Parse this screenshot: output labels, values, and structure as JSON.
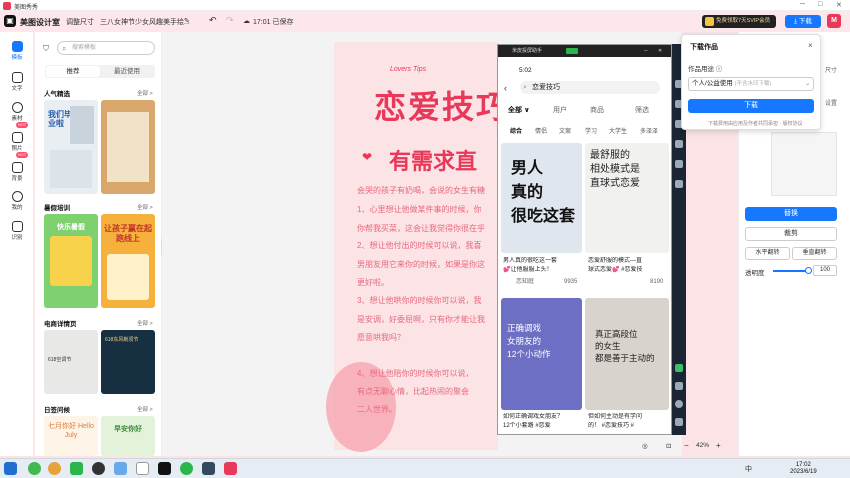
{
  "titlebar": {
    "app_title": "美图秀秀",
    "min": "─",
    "max": "□",
    "close": "✕"
  },
  "toolbar": {
    "brand": "美图设计室",
    "resize": "调整尺寸",
    "doc_title": "三八女神节少女风趣美手绘...",
    "save_status": "17:01 已保存",
    "vip": "免费领取7天SVIP会员",
    "download": "下载",
    "avatar": "M"
  },
  "leftnav": [
    {
      "label": "模板",
      "icon": "template-icon"
    },
    {
      "label": "文字",
      "icon": "text-icon"
    },
    {
      "label": "素材",
      "icon": "material-icon"
    },
    {
      "label": "照片",
      "icon": "photo-icon"
    },
    {
      "label": "背景",
      "icon": "background-icon"
    },
    {
      "label": "我的",
      "icon": "my-icon"
    },
    {
      "label": "识别",
      "icon": "recognize-icon"
    }
  ],
  "hot_badge": "HOT",
  "panel": {
    "search_placeholder": "搜索模板",
    "tabs": [
      "推荐",
      "最近使用"
    ],
    "more": "全部 >",
    "sections": [
      "人气精选",
      "暑假培训",
      "电商详情页",
      "日签问候"
    ],
    "thumb_texts": {
      "t1": "我们毕业啦",
      "t3": "快乐暑假",
      "t4": "让孩子赢在起跑线上",
      "t5": "618空调节",
      "t6": "618东风剃须节",
      "t7": "七月你好 Hello July",
      "t8": "早安你好"
    }
  },
  "poster": {
    "script_top": "Lovers Tips",
    "title": "恋爱技巧",
    "subtitle": "有需求直",
    "lines": [
      "会哭的孩子有奶喝，会说的女生有糖",
      "1、心里想让他做某件事的时候，你",
      "你帮我买菜，这会让我觉得你很在乎",
      "2、想让他付出的时候可以说，我喜",
      "男朋友用它来你的时候，如果是你这",
      "更好啦。",
      "3、想让他哄你的时候你可以说，我",
      "是安调，好委屈啊，只有你才能让我",
      "愿意哄我吗？",
      "4、想让他陪你的时候你可以说，",
      "有点无聊心情，比起热闹的聚会",
      "二人世界。"
    ]
  },
  "phone": {
    "window_title": "米皮投屏助手",
    "status_time": "5:02",
    "search_query": "恋爱技巧",
    "filters": [
      "全部 ∨",
      "用户",
      "商品",
      "筛选"
    ],
    "categories": [
      "综合",
      "情侣",
      "文案",
      "学习",
      "大学生",
      "多泽泽"
    ],
    "cards": [
      {
        "cover": "男人\n真的\n很吃这套",
        "caption1": "男人真的很吃这一套",
        "caption2": "💕让他服服上头！",
        "author": "恋知庭",
        "likes": "9935"
      },
      {
        "cover": "最舒服的\n相处模式是\n直球式恋爱",
        "caption1": "恋爱舒服的模式—直",
        "caption2": "球式恋爱💕 #恋爱技",
        "author": "",
        "likes": "8190"
      },
      {
        "cover": "正确调戏\n女朋友的\n12个小动作",
        "caption1": "如何正确调戏女朋友？",
        "caption2": "12个小套路 #恋爱",
        "author": "",
        "likes": ""
      },
      {
        "cover": "真正高段位\n的女生\n都是善于主动的",
        "caption1": "但如何主动是有学问",
        "caption2": "的！ #恋爱技巧 #",
        "author": "",
        "likes": ""
      }
    ]
  },
  "popover": {
    "title": "下载作品",
    "use_label": "作品用途 ⓘ",
    "use_value": "个人/公益使用",
    "use_hint": "(不含水印下载)",
    "download": "下载",
    "note": "下载费用由应用及作者共同承担 · 版权协议"
  },
  "rpanel": {
    "replace": "替换",
    "crop": "裁剪",
    "flip_h": "水平翻转",
    "flip_v": "垂直翻转",
    "opacity_label": "透明度",
    "opacity_value": "100",
    "peek_1": "尺寸",
    "peek_2": "设置"
  },
  "zoom": {
    "level": "42%",
    "minus": "−",
    "plus": "+"
  },
  "taskbar": {
    "time": "17:02",
    "date": "2023/6/19",
    "lang": "中"
  }
}
